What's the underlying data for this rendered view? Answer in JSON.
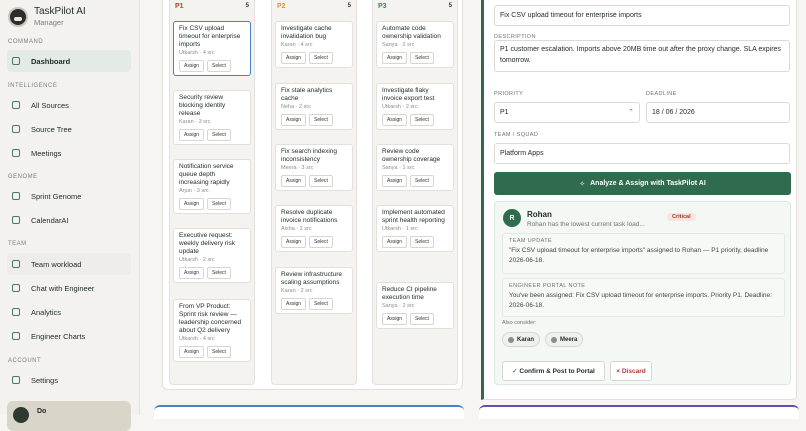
{
  "brand": {
    "name": "TaskPilot AI",
    "role": "Manager"
  },
  "sidebar": {
    "sections": [
      {
        "label": "COMMAND",
        "items": [
          {
            "label": "Dashboard",
            "icon": "home-icon"
          }
        ]
      },
      {
        "label": "INTELLIGENCE",
        "items": [
          {
            "label": "All Sources",
            "icon": "monitor-icon"
          },
          {
            "label": "Source Tree",
            "icon": "list-icon"
          },
          {
            "label": "Meetings",
            "icon": "meeting-icon"
          }
        ]
      },
      {
        "label": "GENOME",
        "items": [
          {
            "label": "Sprint Genome",
            "icon": "genome-icon"
          },
          {
            "label": "CalendarAI",
            "icon": "calendar-icon"
          }
        ]
      },
      {
        "label": "TEAM",
        "items": [
          {
            "label": "Team workload",
            "icon": "team-icon"
          },
          {
            "label": "Chat with Engineer",
            "icon": "chat-icon"
          },
          {
            "label": "Analytics",
            "icon": "chart-icon"
          },
          {
            "label": "Engineer Charts",
            "icon": "chart-icon"
          }
        ]
      },
      {
        "label": "ACCOUNT",
        "items": [
          {
            "label": "Settings",
            "icon": "gear-icon"
          }
        ]
      }
    ],
    "user_short": "Do"
  },
  "board": {
    "buttons": {
      "assign": "Assign",
      "select": "Select"
    },
    "columns": [
      {
        "name": "P1",
        "count": "5",
        "color": "#c0392b",
        "cards": [
          {
            "title": "Fix CSV upload timeout for enterprise imports",
            "meta": "Utkarsh · 4 src"
          },
          {
            "title": "Security review blocking identity release",
            "meta": "Karan · 3 src"
          },
          {
            "title": "Notification service queue depth increasing rapidly",
            "meta": "Arjun · 3 src"
          },
          {
            "title": "Executive request: weekly delivery risk update",
            "meta": "Utkarsh · 2 src"
          },
          {
            "title": "From VP Product: Sprint risk review — leadership concerned about Q2 delivery",
            "meta": "Utkarsh · 4 src"
          }
        ]
      },
      {
        "name": "P2",
        "count": "5",
        "color": "#d4a017",
        "cards": [
          {
            "title": "Investigate cache invalidation bug",
            "meta": "Karan · 4 src"
          },
          {
            "title": "Fix stale analytics cache",
            "meta": "Neha · 2 src"
          },
          {
            "title": "Fix search indexing inconsistency",
            "meta": "Meera · 3 src"
          },
          {
            "title": "Resolve duplicate invoice notifications",
            "meta": "Aisha · 2 src"
          },
          {
            "title": "Review infrastructure scaling assumptions",
            "meta": "Karan · 2 src"
          }
        ]
      },
      {
        "name": "P3",
        "count": "5",
        "color": "#3a8a55",
        "cards": [
          {
            "title": "Automate code ownership validation",
            "meta": "Sanya · 2 src"
          },
          {
            "title": "Investigate flaky invoice export test",
            "meta": "Utkarsh · 2 src"
          },
          {
            "title": "Review code ownership coverage",
            "meta": "Sanya · 1 src"
          },
          {
            "title": "Implement automated sprint health reporting",
            "meta": "Utkarsh · 1 src"
          },
          {
            "title": "Reduce CI pipeline execution time",
            "meta": "Sanya · 2 src"
          }
        ]
      }
    ]
  },
  "form": {
    "title_value": "Fix CSV upload timeout for enterprise imports",
    "description_label": "DESCRIPTION",
    "description_value": "P1 customer escalation. Imports above 20MB time out after the proxy change. SLA expires tomorrow.",
    "priority_label": "PRIORITY",
    "priority_value": "P1",
    "deadline_label": "DEADLINE",
    "deadline_value": "18 / 06 / 2026",
    "team_label": "TEAM / SQUAD",
    "team_value": "Platform Apps",
    "analyze_label": "Analyze & Assign with TaskPilot AI"
  },
  "result": {
    "avatar": "R",
    "name": "Rohan",
    "reason": "Rohan has the lowest current task load...",
    "badge": "Critical",
    "team_update_label": "TEAM UPDATE",
    "team_update_text": "\"Fix CSV upload timeout for enterprise imports\" assigned to Rohan — P1 priority, deadline 2026-06-18.",
    "portal_label": "ENGINEER PORTAL NOTE",
    "portal_text": "You've been assigned: Fix CSV upload timeout for enterprise imports. Priority P1. Deadline: 2026-06-18.",
    "also_consider": "Also consider:",
    "alternatives": [
      "Karan",
      "Meera"
    ],
    "confirm_label": "✓ Confirm & Post to Portal",
    "discard_label": "× Discard"
  }
}
